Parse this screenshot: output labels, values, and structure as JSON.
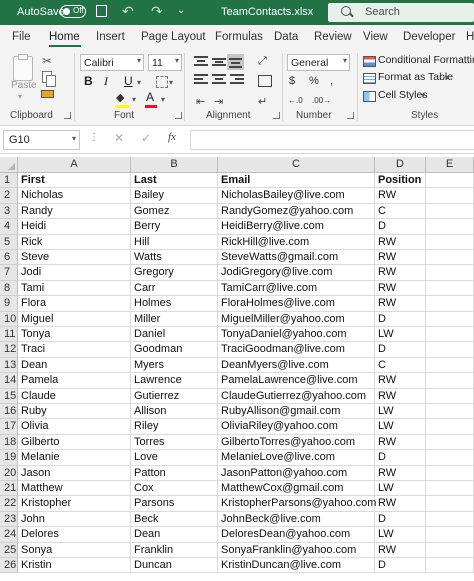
{
  "title_bar": {
    "autosave_label": "AutoSave",
    "autosave_state": "Off",
    "filename": "TeamContacts.xlsx",
    "search_placeholder": "Search",
    "more_label": "⌄",
    "bg_color": "#217346"
  },
  "menu": {
    "tabs": [
      "File",
      "Home",
      "Insert",
      "Page Layout",
      "Formulas",
      "Data",
      "Review",
      "View",
      "Developer",
      "H"
    ],
    "active_tab": "Home"
  },
  "ribbon": {
    "groups": [
      "Clipboard",
      "Font",
      "Alignment",
      "Number",
      "Styles"
    ],
    "paste_label": "Paste",
    "font_name": "Calibri",
    "font_size": "11",
    "number_format": "General",
    "styles_items": [
      "Conditional Formatting",
      "Format as Table",
      "Cell Styles"
    ]
  },
  "formula_bar": {
    "name_box": "G10",
    "formula": ""
  },
  "sheet": {
    "columns": [
      "A",
      "B",
      "C",
      "D",
      "E"
    ],
    "header": [
      "First",
      "Last",
      "Email",
      "Position"
    ],
    "rows": [
      [
        "Nicholas",
        "Bailey",
        "NicholasBailey@live.com",
        "RW"
      ],
      [
        "Randy",
        "Gomez",
        "RandyGomez@yahoo.com",
        "C"
      ],
      [
        "Heidi",
        "Berry",
        "HeidiBerry@live.com",
        "D"
      ],
      [
        "Rick",
        "Hill",
        "RickHill@live.com",
        "RW"
      ],
      [
        "Steve",
        "Watts",
        "SteveWatts@gmail.com",
        "RW"
      ],
      [
        "Jodi",
        "Gregory",
        "JodiGregory@live.com",
        "RW"
      ],
      [
        "Tami",
        "Carr",
        "TamiCarr@live.com",
        "RW"
      ],
      [
        "Flora",
        "Holmes",
        "FloraHolmes@live.com",
        "RW"
      ],
      [
        "Miguel",
        "Miller",
        "MiguelMiller@yahoo.com",
        "D"
      ],
      [
        "Tonya",
        "Daniel",
        "TonyaDaniel@yahoo.com",
        "LW"
      ],
      [
        "Traci",
        "Goodman",
        "TraciGoodman@live.com",
        "D"
      ],
      [
        "Dean",
        "Myers",
        "DeanMyers@live.com",
        "C"
      ],
      [
        "Pamela",
        "Lawrence",
        "PamelaLawrence@live.com",
        "RW"
      ],
      [
        "Claude",
        "Gutierrez",
        "ClaudeGutierrez@yahoo.com",
        "RW"
      ],
      [
        "Ruby",
        "Allison",
        "RubyAllison@gmail.com",
        "LW"
      ],
      [
        "Olivia",
        "Riley",
        "OliviaRiley@yahoo.com",
        "LW"
      ],
      [
        "Gilberto",
        "Torres",
        "GilbertoTorres@yahoo.com",
        "RW"
      ],
      [
        "Melanie",
        "Love",
        "MelanieLove@live.com",
        "D"
      ],
      [
        "Jason",
        "Patton",
        "JasonPatton@yahoo.com",
        "RW"
      ],
      [
        "Matthew",
        "Cox",
        "MatthewCox@gmail.com",
        "LW"
      ],
      [
        "Kristopher",
        "Parsons",
        "KristopherParsons@yahoo.com",
        "RW"
      ],
      [
        "John",
        "Beck",
        "JohnBeck@live.com",
        "D"
      ],
      [
        "Delores",
        "Dean",
        "DeloresDean@yahoo.com",
        "LW"
      ],
      [
        "Sonya",
        "Franklin",
        "SonyaFranklin@yahoo.com",
        "RW"
      ],
      [
        "Kristin",
        "Duncan",
        "KristinDuncan@live.com",
        "D"
      ]
    ]
  }
}
